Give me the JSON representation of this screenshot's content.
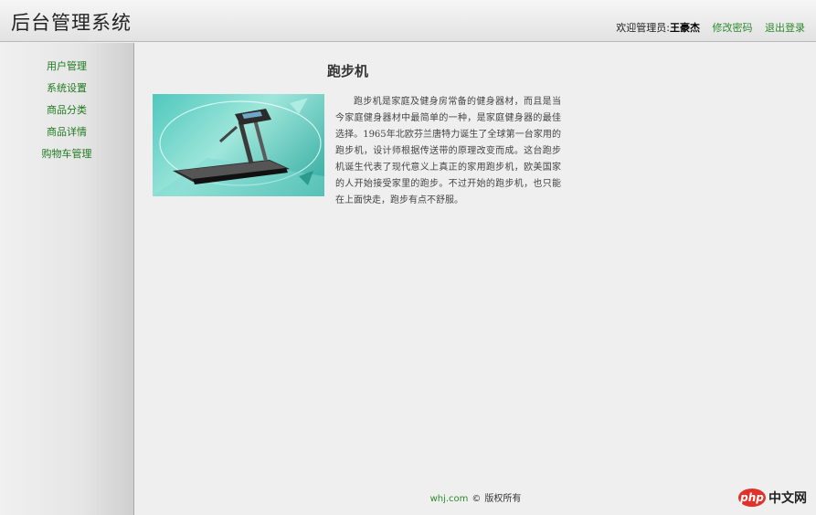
{
  "header": {
    "app_title": "后台管理系统",
    "welcome_label": "欢迎管理员:",
    "username": "王豪杰",
    "change_password": "修改密码",
    "logout": "退出登录"
  },
  "sidebar": {
    "items": [
      {
        "label": "用户管理"
      },
      {
        "label": "系统设置"
      },
      {
        "label": "商品分类"
      },
      {
        "label": "商品详情"
      },
      {
        "label": "购物车管理"
      }
    ]
  },
  "article": {
    "title": "跑步机",
    "body": "跑步机是家庭及健身房常备的健身器材，而且是当今家庭健身器材中最简单的一种，是家庭健身器的最佳选择。1965年北欧芬兰唐特力诞生了全球第一台家用的跑步机，设计师根据传送带的原理改变而成。这台跑步机诞生代表了现代意义上真正的家用跑步机，欧美国家的人开始接受家里的跑步。不过开始的跑步机，也只能在上面快走，跑步有点不舒服。",
    "image_alt": "treadmill-image"
  },
  "footer": {
    "site": "whj.com",
    "copyright_symbol": "©",
    "rights": "版权所有"
  },
  "watermark": {
    "brand": "php",
    "text": "中文网"
  },
  "colors": {
    "link_green": "#2c8a2c",
    "nav_green": "#1e7a1e",
    "background": "#efefef"
  }
}
